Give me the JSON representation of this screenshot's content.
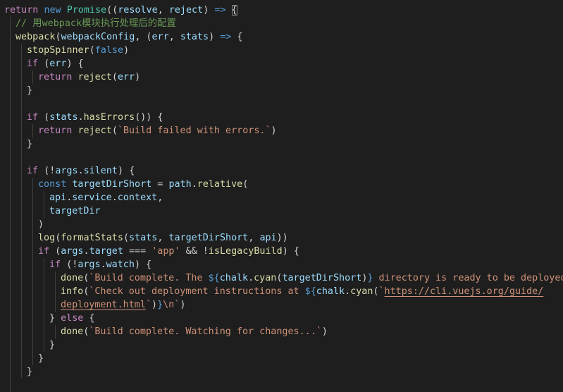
{
  "editor": {
    "lines": [
      [
        [
          "return ",
          "ctl"
        ],
        [
          "new ",
          "kw"
        ],
        [
          "Promise",
          "cls"
        ],
        [
          "((",
          "pl"
        ],
        [
          "resolve",
          "var"
        ],
        [
          ", ",
          "pl"
        ],
        [
          "reject",
          "var"
        ],
        [
          ") ",
          "pl"
        ],
        [
          "=>",
          "kw"
        ],
        [
          " ",
          "pl"
        ],
        [
          "{",
          "pl"
        ]
      ],
      [
        [
          "// 用webpack模块执行处理后的配置",
          "cmt"
        ]
      ],
      [
        [
          "webpack",
          "fn"
        ],
        [
          "(",
          "pl"
        ],
        [
          "webpackConfig",
          "var"
        ],
        [
          ", (",
          "pl"
        ],
        [
          "err",
          "var"
        ],
        [
          ", ",
          "pl"
        ],
        [
          "stats",
          "var"
        ],
        [
          ") ",
          "pl"
        ],
        [
          "=>",
          "kw"
        ],
        [
          " {",
          "pl"
        ]
      ],
      [
        [
          "stopSpinner",
          "fn"
        ],
        [
          "(",
          "pl"
        ],
        [
          "false",
          "kw"
        ],
        [
          ")",
          "pl"
        ]
      ],
      [
        [
          "if",
          "ctl"
        ],
        [
          " (",
          "pl"
        ],
        [
          "err",
          "var"
        ],
        [
          ") {",
          "pl"
        ]
      ],
      [
        [
          "return ",
          "ctl"
        ],
        [
          "reject",
          "fn"
        ],
        [
          "(",
          "pl"
        ],
        [
          "err",
          "var"
        ],
        [
          ")",
          "pl"
        ]
      ],
      [
        [
          "}",
          "pl"
        ]
      ],
      [],
      [
        [
          "if",
          "ctl"
        ],
        [
          " (",
          "pl"
        ],
        [
          "stats",
          "var"
        ],
        [
          ".",
          "pl"
        ],
        [
          "hasErrors",
          "fn"
        ],
        [
          "()) {",
          "pl"
        ]
      ],
      [
        [
          "return ",
          "ctl"
        ],
        [
          "reject",
          "fn"
        ],
        [
          "(",
          "pl"
        ],
        [
          "`Build failed with errors.`",
          "str"
        ],
        [
          ")",
          "pl"
        ]
      ],
      [
        [
          "}",
          "pl"
        ]
      ],
      [],
      [
        [
          "if",
          "ctl"
        ],
        [
          " (!",
          "pl"
        ],
        [
          "args",
          "var"
        ],
        [
          ".",
          "pl"
        ],
        [
          "silent",
          "var"
        ],
        [
          ") {",
          "pl"
        ]
      ],
      [
        [
          "const ",
          "kw"
        ],
        [
          "targetDirShort",
          "var"
        ],
        [
          " = ",
          "pl"
        ],
        [
          "path",
          "var"
        ],
        [
          ".",
          "pl"
        ],
        [
          "relative",
          "fn"
        ],
        [
          "(",
          "pl"
        ]
      ],
      [
        [
          "api",
          "var"
        ],
        [
          ".",
          "pl"
        ],
        [
          "service",
          "var"
        ],
        [
          ".",
          "pl"
        ],
        [
          "context",
          "var"
        ],
        [
          ",",
          "pl"
        ]
      ],
      [
        [
          "targetDir",
          "var"
        ]
      ],
      [
        [
          ")",
          "pl"
        ]
      ],
      [
        [
          "log",
          "fn"
        ],
        [
          "(",
          "pl"
        ],
        [
          "formatStats",
          "fn"
        ],
        [
          "(",
          "pl"
        ],
        [
          "stats",
          "var"
        ],
        [
          ", ",
          "pl"
        ],
        [
          "targetDirShort",
          "var"
        ],
        [
          ", ",
          "pl"
        ],
        [
          "api",
          "var"
        ],
        [
          "))",
          "pl"
        ]
      ],
      [
        [
          "if",
          "ctl"
        ],
        [
          " (",
          "pl"
        ],
        [
          "args",
          "var"
        ],
        [
          ".",
          "pl"
        ],
        [
          "target",
          "var"
        ],
        [
          " === ",
          "pl"
        ],
        [
          "'app'",
          "str"
        ],
        [
          " && !",
          "pl"
        ],
        [
          "isLegacyBuild",
          "fn"
        ],
        [
          ") {",
          "pl"
        ]
      ],
      [
        [
          "if",
          "ctl"
        ],
        [
          " (!",
          "pl"
        ],
        [
          "args",
          "var"
        ],
        [
          ".",
          "pl"
        ],
        [
          "watch",
          "var"
        ],
        [
          ") {",
          "pl"
        ]
      ],
      [
        [
          "done",
          "fn"
        ],
        [
          "(",
          "pl"
        ],
        [
          "`Build complete. The ",
          "str"
        ],
        [
          "${",
          "tin"
        ],
        [
          "chalk",
          "var"
        ],
        [
          ".",
          "pl"
        ],
        [
          "cyan",
          "fn"
        ],
        [
          "(",
          "pl"
        ],
        [
          "targetDirShort",
          "var"
        ],
        [
          ")",
          "pl"
        ],
        [
          "}",
          "tin"
        ],
        [
          " directory is ready to be deployed.`",
          "str"
        ],
        [
          ")",
          "pl"
        ]
      ],
      [
        [
          "info",
          "fn"
        ],
        [
          "(",
          "pl"
        ],
        [
          "`Check out deployment instructions at ",
          "str"
        ],
        [
          "${",
          "tin"
        ],
        [
          "chalk",
          "var"
        ],
        [
          ".",
          "pl"
        ],
        [
          "cyan",
          "fn"
        ],
        [
          "(",
          "pl"
        ],
        [
          "`",
          "str"
        ],
        [
          "https://cli.vuejs.org/guide/",
          "str ul"
        ]
      ],
      [
        [
          "deployment.html",
          "str ul"
        ],
        [
          "`",
          "str"
        ],
        [
          ")",
          "pl"
        ],
        [
          "}",
          "tin"
        ],
        [
          "\\n`",
          "str"
        ],
        [
          ")",
          "pl"
        ]
      ],
      [
        [
          "} ",
          "pl"
        ],
        [
          "else",
          "ctl"
        ],
        [
          " {",
          "pl"
        ]
      ],
      [
        [
          "done",
          "fn"
        ],
        [
          "(",
          "pl"
        ],
        [
          "`Build complete. Watching for changes...`",
          "str"
        ],
        [
          ")",
          "pl"
        ]
      ],
      [
        [
          "}",
          "pl"
        ]
      ],
      [
        [
          "}",
          "pl"
        ]
      ],
      [
        [
          "}",
          "pl"
        ]
      ]
    ]
  }
}
